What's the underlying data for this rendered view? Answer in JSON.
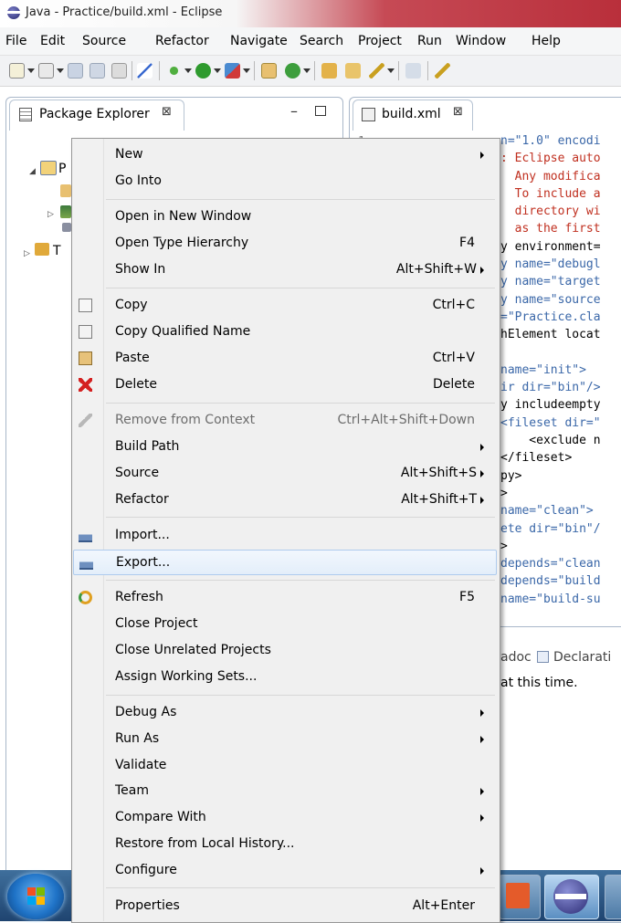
{
  "window": {
    "title": "Java - Practice/build.xml - Eclipse"
  },
  "menubar": [
    "File",
    "Edit",
    "Source",
    "Refactor",
    "Navigate",
    "Search",
    "Project",
    "Run",
    "Window",
    "Help"
  ],
  "package_explorer": {
    "tab_label": "Package Explorer",
    "close_glyph": "⊠",
    "tree": [
      {
        "label": "P"
      },
      {
        "label": "T"
      }
    ]
  },
  "editor": {
    "tab_label": "build.xml",
    "close_glyph": "⊠",
    "line_number": "1",
    "code_lines": [
      "n=\"1.0\" encodi",
      ": Eclipse auto",
      "  Any modifica",
      "  To include a",
      "  directory wi",
      "  as the first",
      "y environment=",
      "y name=\"debugl",
      "y name=\"target",
      "y name=\"source",
      "=\"Practice.cla",
      "hElement locat",
      "",
      "name=\"init\">",
      "ir dir=\"bin\"/>",
      "y includeempty",
      "<fileset dir=\"",
      "    <exclude n",
      "</fileset>",
      "py>",
      ">",
      "name=\"clean\">",
      "ete dir=\"bin\"/",
      ">",
      "depends=\"clean",
      "depends=\"build",
      "name=\"build-su"
    ]
  },
  "bottom_panel": {
    "tab_javadoc": "adoc",
    "tab_declaration": "Declarati",
    "message": "at this time."
  },
  "context_menu": {
    "items": [
      {
        "label": "New",
        "shortcut": "",
        "submenu": true,
        "icon": ""
      },
      {
        "label": "Go Into",
        "shortcut": "",
        "submenu": false,
        "icon": ""
      },
      {
        "label": "Open in New Window",
        "shortcut": "",
        "submenu": false,
        "icon": ""
      },
      {
        "label": "Open Type Hierarchy",
        "shortcut": "F4",
        "submenu": false,
        "icon": ""
      },
      {
        "label": "Show In",
        "shortcut": "Alt+Shift+W",
        "submenu": true,
        "icon": ""
      },
      {
        "label": "Copy",
        "shortcut": "Ctrl+C",
        "submenu": false,
        "icon": "copy-icon"
      },
      {
        "label": "Copy Qualified Name",
        "shortcut": "",
        "submenu": false,
        "icon": "copy-qualified-name-icon"
      },
      {
        "label": "Paste",
        "shortcut": "Ctrl+V",
        "submenu": false,
        "icon": "paste-icon"
      },
      {
        "label": "Delete",
        "shortcut": "Delete",
        "submenu": false,
        "icon": "delete-icon"
      },
      {
        "label": "Remove from Context",
        "shortcut": "Ctrl+Alt+Shift+Down",
        "submenu": false,
        "disabled": true,
        "icon": "remove-from-context-icon"
      },
      {
        "label": "Build Path",
        "shortcut": "",
        "submenu": true,
        "icon": ""
      },
      {
        "label": "Source",
        "shortcut": "Alt+Shift+S",
        "submenu": true,
        "icon": ""
      },
      {
        "label": "Refactor",
        "shortcut": "Alt+Shift+T",
        "submenu": true,
        "icon": ""
      },
      {
        "label": "Import...",
        "shortcut": "",
        "submenu": false,
        "icon": "import-icon"
      },
      {
        "label": "Export...",
        "shortcut": "",
        "submenu": false,
        "highlighted": true,
        "icon": "export-icon"
      },
      {
        "label": "Refresh",
        "shortcut": "F5",
        "submenu": false,
        "icon": "refresh-icon"
      },
      {
        "label": "Close Project",
        "shortcut": "",
        "submenu": false,
        "icon": ""
      },
      {
        "label": "Close Unrelated Projects",
        "shortcut": "",
        "submenu": false,
        "icon": ""
      },
      {
        "label": "Assign Working Sets...",
        "shortcut": "",
        "submenu": false,
        "icon": ""
      },
      {
        "label": "Debug As",
        "shortcut": "",
        "submenu": true,
        "icon": ""
      },
      {
        "label": "Run As",
        "shortcut": "",
        "submenu": true,
        "icon": ""
      },
      {
        "label": "Validate",
        "shortcut": "",
        "submenu": false,
        "icon": ""
      },
      {
        "label": "Team",
        "shortcut": "",
        "submenu": true,
        "icon": ""
      },
      {
        "label": "Compare With",
        "shortcut": "",
        "submenu": true,
        "icon": ""
      },
      {
        "label": "Restore from Local History...",
        "shortcut": "",
        "submenu": false,
        "icon": ""
      },
      {
        "label": "Configure",
        "shortcut": "",
        "submenu": true,
        "icon": ""
      },
      {
        "label": "Properties",
        "shortcut": "Alt+Enter",
        "submenu": false,
        "icon": ""
      }
    ]
  },
  "colors": {
    "menu_highlight": "#e3eefa",
    "code_comment": "#c03020",
    "code_tag": "#3a67a8",
    "code_string": "#2a2aa5",
    "delete_icon": "#d42020"
  }
}
